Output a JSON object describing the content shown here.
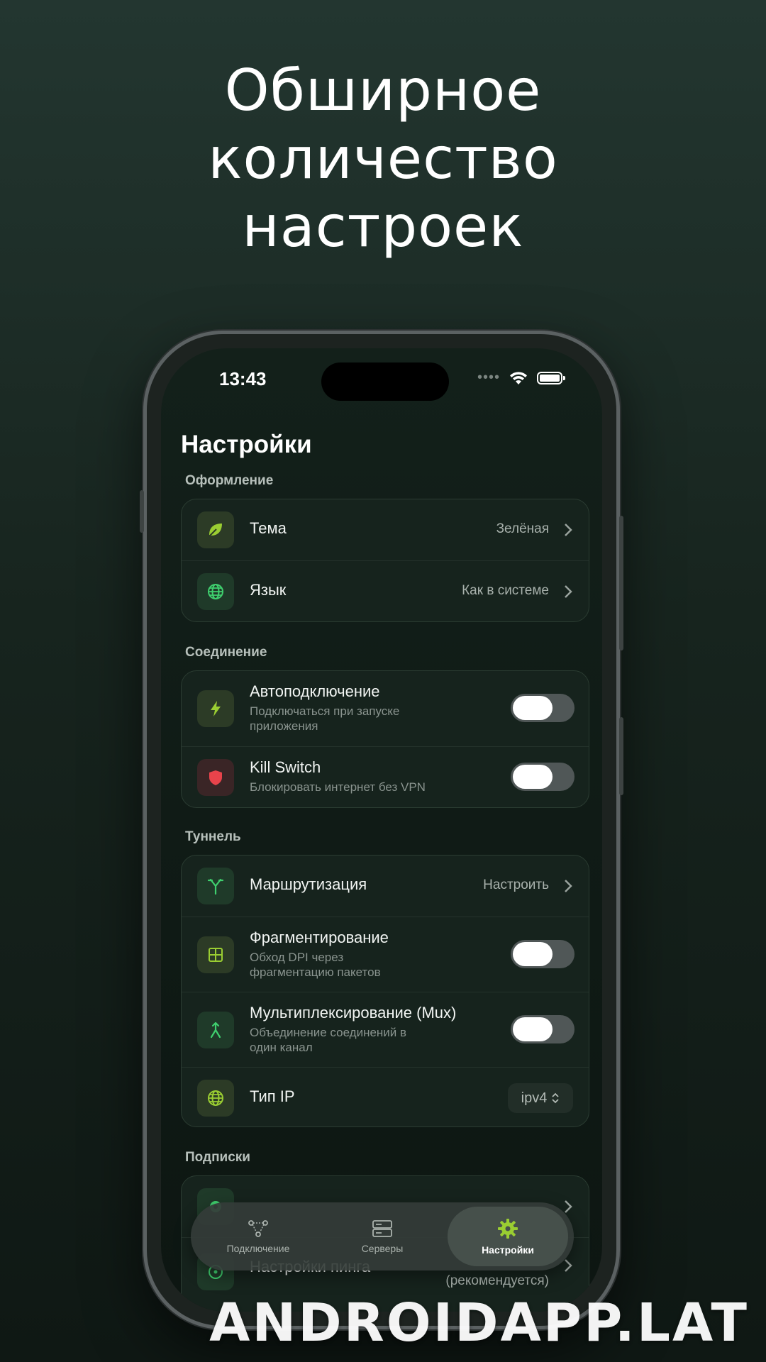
{
  "headline": [
    "Обширное",
    "количество",
    "настроек"
  ],
  "status_bar": {
    "time": "13:43",
    "dots": "••••"
  },
  "page": {
    "title": "Настройки"
  },
  "sections": [
    {
      "label": "Оформление",
      "rows": [
        {
          "title": "Тема",
          "value": "Зелёная",
          "icon": "leaf-icon"
        },
        {
          "title": "Язык",
          "value": "Как в системе",
          "icon": "globe-icon"
        }
      ]
    },
    {
      "label": "Соединение",
      "rows": [
        {
          "title": "Автоподключение",
          "subtitle": "Подключаться при запуске приложения",
          "toggle_on": false,
          "icon": "bolt-icon"
        },
        {
          "title": "Kill Switch",
          "subtitle": "Блокировать интернет без VPN",
          "toggle_on": false,
          "icon": "shield-icon"
        }
      ]
    },
    {
      "label": "Туннель",
      "rows": [
        {
          "title": "Маршрутизация",
          "value": "Настроить",
          "icon": "route-split-icon"
        },
        {
          "title": "Фрагментирование",
          "subtitle": "Обход DPI через фрагментацию пакетов",
          "toggle_on": false,
          "icon": "grid-icon"
        },
        {
          "title": "Мультиплексирование (Mux)",
          "subtitle": "Объединение соединений в один канал",
          "toggle_on": false,
          "icon": "merge-icon"
        },
        {
          "title": "Тип IP",
          "value": "ipv4",
          "icon": "globe-icon"
        }
      ]
    },
    {
      "label": "Подписки",
      "rows": [
        {
          "title": "",
          "icon": "gear-icon"
        },
        {
          "title": "Настройки пинга",
          "value": "(рекомендуется)",
          "icon": "ping-icon"
        }
      ]
    }
  ],
  "tabbar": {
    "tabs": [
      {
        "label": "Подключение",
        "icon": "nodes-icon",
        "active": false
      },
      {
        "label": "Серверы",
        "icon": "server-icon",
        "active": false
      },
      {
        "label": "Настройки",
        "icon": "gear-icon",
        "active": true
      }
    ]
  },
  "watermark": "ANDROIDAPP.LAT",
  "colors": {
    "accent_green": "#9acd32",
    "icon_green": "#3fcf6e",
    "kill_switch_red": "#e8434b",
    "background": "#17241e"
  }
}
